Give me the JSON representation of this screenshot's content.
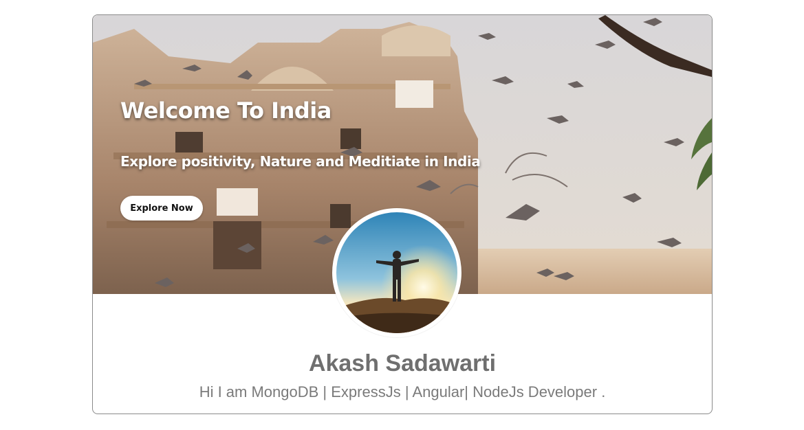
{
  "hero": {
    "title": "Welcome To India",
    "subtitle": "Explore positivity, Nature and Meditiate in India",
    "cta_label": "Explore Now"
  },
  "profile": {
    "name": "Akash Sadawarti",
    "bio": "Hi I am MongoDB | ExpressJs | Angular| NodeJs Developer ."
  },
  "colors": {
    "card_border": "#8a8a8a",
    "name_text": "#6f6f6f",
    "bio_text": "#7a7a7a",
    "hero_text": "#ffffff"
  }
}
